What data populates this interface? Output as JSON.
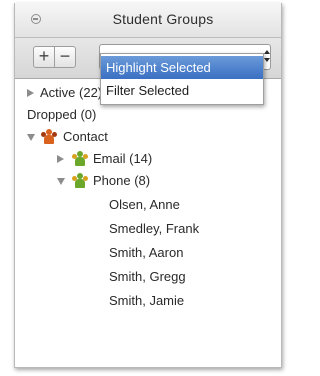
{
  "window": {
    "title": "Student Groups"
  },
  "toolbar": {
    "add_label": "+",
    "remove_label": "−",
    "action_menu": {
      "selected": "Highlight Selected",
      "options": [
        "Highlight Selected",
        "Filter Selected"
      ]
    }
  },
  "tree": {
    "active": "Active (22)",
    "dropped": "Dropped (0)",
    "contact": {
      "label": "Contact",
      "email": "Email (14)",
      "phone": {
        "label": "Phone (8)",
        "members": [
          "Olsen, Anne",
          "Smedley, Frank",
          "Smith, Aaron",
          "Smith, Gregg",
          "Smith, Jamie"
        ]
      }
    }
  },
  "colors": {
    "selection": "#3a6fc3",
    "group_icon_orange": "#d9631e",
    "group_icon_green": "#6aa72b"
  }
}
